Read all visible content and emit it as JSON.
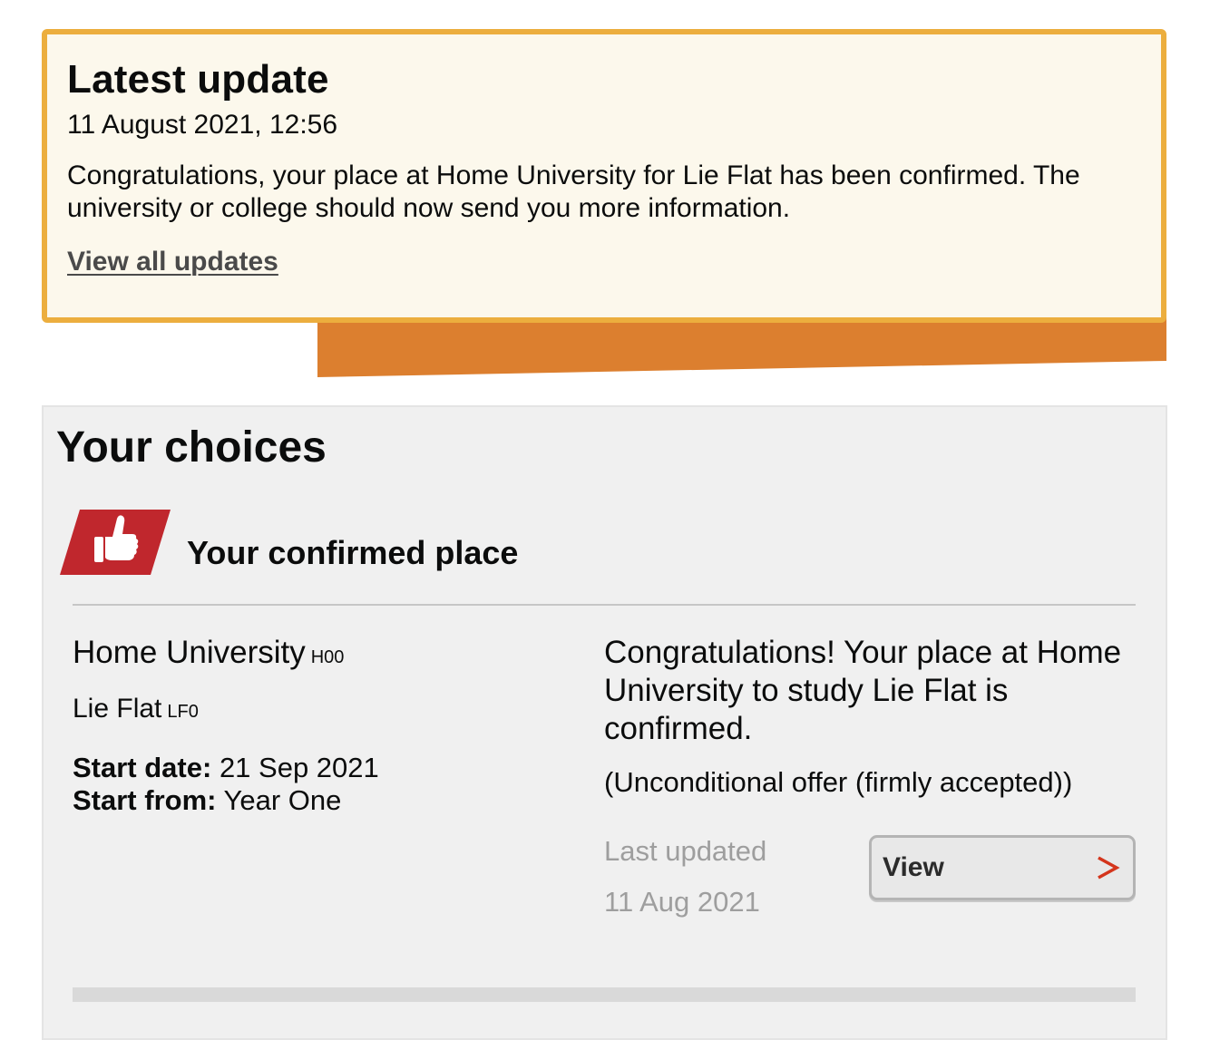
{
  "latest_update": {
    "title": "Latest update",
    "date": "11 August 2021, 12:56",
    "message": "Congratulations, your place at Home University for Lie Flat has been confirmed. The university or college should now send you more information.",
    "link_label": "View all updates"
  },
  "choices": {
    "title": "Your choices",
    "confirmed_heading": "Your confirmed place",
    "confirmed_icon": "thumbs-up-icon",
    "place": {
      "university": "Home University",
      "university_code": "H00",
      "course": "Lie Flat",
      "course_code": "LF0",
      "start_date_label": "Start date:",
      "start_date": "21 Sep 2021",
      "start_from_label": "Start from:",
      "start_from": "Year One",
      "status_message": "Congratulations! Your place at Home University to study Lie Flat is confirmed.",
      "offer_type": "(Unconditional offer (firmly accepted))",
      "last_updated_label": "Last updated",
      "last_updated_date": "11 Aug 2021",
      "view_label": "View",
      "view_icon": "chevron-right-icon"
    }
  },
  "colors": {
    "update_border": "#ecae3e",
    "update_background": "#fcf8ec",
    "ribbon": "#dc7f2f",
    "panel_background": "#f0f0f0",
    "icon_red": "#c0272d",
    "chevron_red": "#d4351c"
  }
}
